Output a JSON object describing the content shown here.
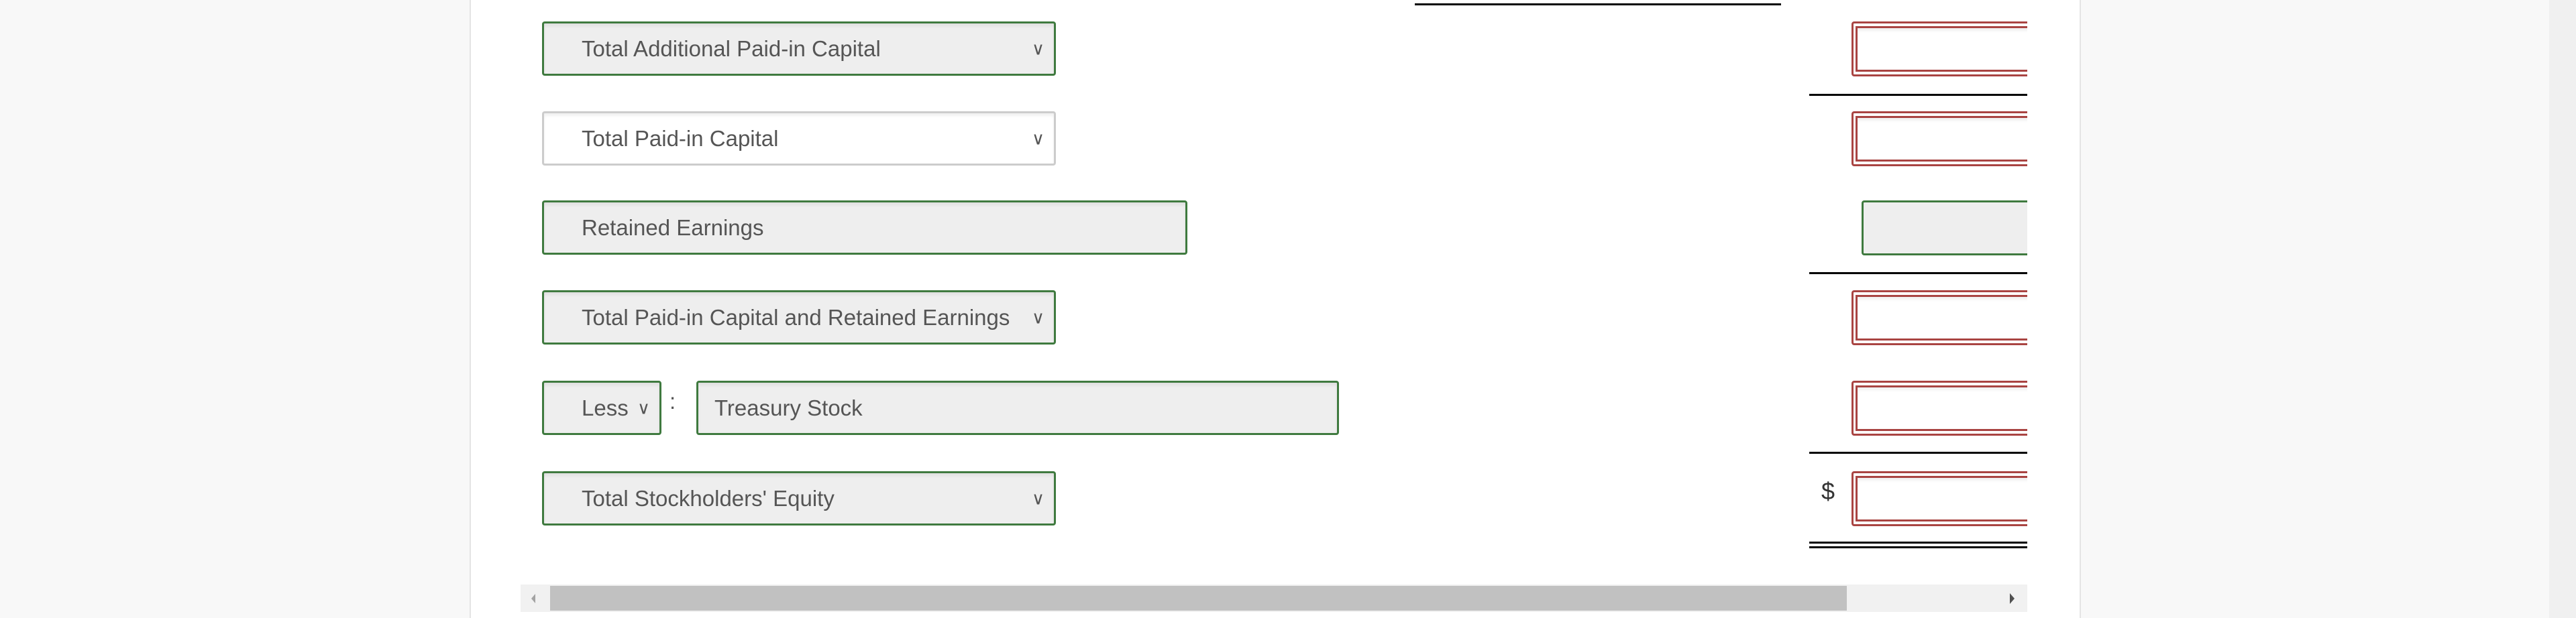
{
  "rows": [
    {
      "label": "Total Additional Paid-in Capital",
      "type": "select"
    },
    {
      "label": "Total Paid-in Capital",
      "type": "select"
    },
    {
      "label": "Retained Earnings",
      "type": "input"
    },
    {
      "label": "Total Paid-in Capital and Retained Earnings",
      "type": "select"
    },
    {
      "prefix": "Less",
      "separator": ":",
      "label": "Treasury Stock",
      "type": "input"
    },
    {
      "label": "Total Stockholders' Equity",
      "type": "select"
    }
  ],
  "currency_symbol": "$",
  "icons": {
    "dropdown": "chevron-down-icon",
    "scroll_left": "triangle-left-icon",
    "scroll_right": "triangle-right-icon"
  },
  "colors": {
    "correct": "#3f7a3f",
    "incorrect": "#a94442"
  }
}
